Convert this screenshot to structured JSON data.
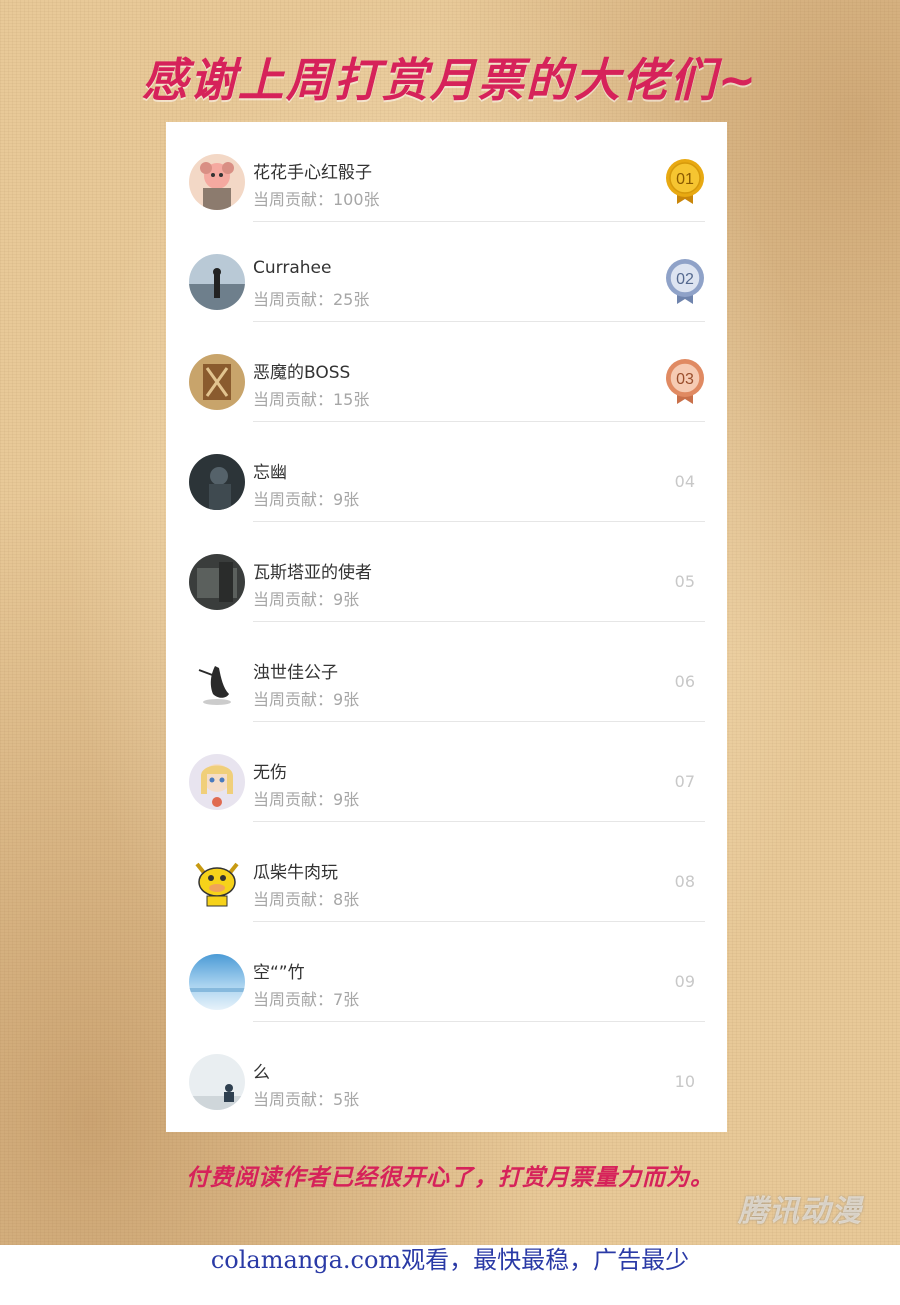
{
  "poster": {
    "headline": "感谢上周打赏月票的大佬们~",
    "footer_note": "付费阅读作者已经很开心了，打赏月票量力而为。",
    "watermark": "腾讯动漫"
  },
  "leaderboard": [
    {
      "name": "花花手心红骰子",
      "contribution": "当周贡献：100张",
      "rank": "01",
      "medal": "gold"
    },
    {
      "name": "Currahee",
      "contribution": "当周贡献：25张",
      "rank": "02",
      "medal": "silver"
    },
    {
      "name": "恶魔的BOSS",
      "contribution": "当周贡献：15张",
      "rank": "03",
      "medal": "bronze"
    },
    {
      "name": "忘幽",
      "contribution": "当周贡献：9张",
      "rank": "04"
    },
    {
      "name": "瓦斯塔亚的使者",
      "contribution": "当周贡献：9张",
      "rank": "05"
    },
    {
      "name": "浊世佳公子",
      "contribution": "当周贡献：9张",
      "rank": "06"
    },
    {
      "name": "无伤",
      "contribution": "当周贡献：9张",
      "rank": "07"
    },
    {
      "name": "瓜柴牛肉玩",
      "contribution": "当周贡献：8张",
      "rank": "08"
    },
    {
      "name": "空“”竹",
      "contribution": "当周贡献：7张",
      "rank": "09"
    },
    {
      "name": "么",
      "contribution": "当周贡献：5张",
      "rank": "10"
    }
  ],
  "medal_colors": {
    "gold": "#e8a912",
    "silver": "#8fa2c8",
    "bronze": "#e08a62"
  },
  "accent_color": "#d6225a",
  "site_banner": "colamanga.com观看，最快最稳，广告最少"
}
